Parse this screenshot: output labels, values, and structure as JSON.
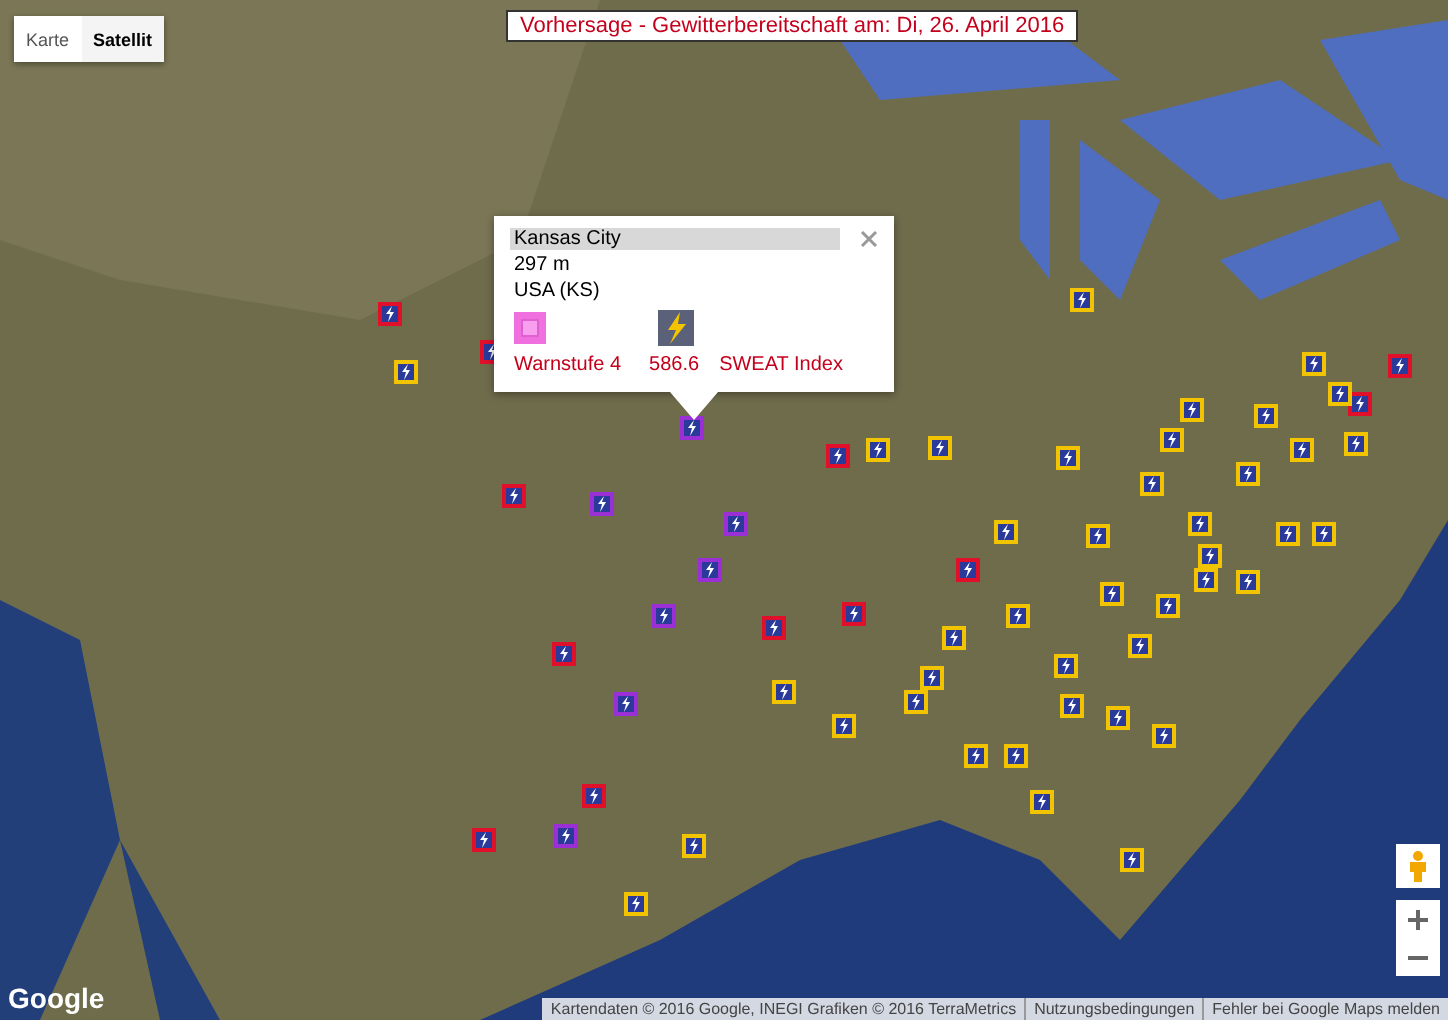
{
  "map_type_buttons": [
    {
      "label": "Karte",
      "selected": false
    },
    {
      "label": "Satellit",
      "selected": true
    }
  ],
  "title": "Vorhersage - Gewitterbereitschaft am: Di, 26. April 2016",
  "popup": {
    "place": "Kansas City",
    "elevation": "297 m",
    "region": "USA (KS)",
    "warning_label": "Warnstufe 4",
    "index_value": "586.6",
    "index_label": "SWEAT Index"
  },
  "markers": [
    {
      "color": "#e0102a"
    },
    {
      "color": "#e0102a"
    },
    {
      "color": "#e0102a"
    },
    {
      "color": "#e0102a"
    },
    {
      "color": "#e0102a"
    },
    {
      "color": "#e0102a"
    },
    {
      "color": "#e0102a"
    },
    {
      "color": "#e0102a"
    },
    {
      "color": "#e0102a"
    },
    {
      "color": "#e0102a"
    },
    {
      "color": "#e0102a"
    },
    {
      "color": "#e0102a"
    },
    {
      "color": "#9b2fd6"
    },
    {
      "color": "#9b2fd6"
    },
    {
      "color": "#9b2fd6"
    },
    {
      "color": "#9b2fd6"
    },
    {
      "color": "#9b2fd6"
    },
    {
      "color": "#9b2fd6"
    },
    {
      "color": "#9b2fd6"
    },
    {
      "color": "#f2c400"
    },
    {
      "color": "#f2c400"
    },
    {
      "color": "#f2c400"
    },
    {
      "color": "#f2c400"
    },
    {
      "color": "#f2c400"
    },
    {
      "color": "#f2c400"
    },
    {
      "color": "#f2c400"
    },
    {
      "color": "#f2c400"
    },
    {
      "color": "#f2c400"
    },
    {
      "color": "#f2c400"
    },
    {
      "color": "#f2c400"
    },
    {
      "color": "#f2c400"
    },
    {
      "color": "#f2c400"
    },
    {
      "color": "#f2c400"
    },
    {
      "color": "#f2c400"
    },
    {
      "color": "#f2c400"
    },
    {
      "color": "#f2c400"
    },
    {
      "color": "#f2c400"
    },
    {
      "color": "#f2c400"
    },
    {
      "color": "#f2c400"
    },
    {
      "color": "#f2c400"
    },
    {
      "color": "#f2c400"
    },
    {
      "color": "#f2c400"
    },
    {
      "color": "#f2c400"
    },
    {
      "color": "#f2c400"
    },
    {
      "color": "#f2c400"
    },
    {
      "color": "#f2c400"
    },
    {
      "color": "#f2c400"
    },
    {
      "color": "#f2c400"
    },
    {
      "color": "#f2c400"
    },
    {
      "color": "#f2c400"
    },
    {
      "color": "#f2c400"
    },
    {
      "color": "#f2c400"
    },
    {
      "color": "#f2c400"
    },
    {
      "color": "#f2c400"
    },
    {
      "color": "#f2c400"
    },
    {
      "color": "#f2c400"
    },
    {
      "color": "#f2c400"
    },
    {
      "color": "#f2c400"
    },
    {
      "color": "#f2c400"
    },
    {
      "color": "#f2c400"
    }
  ],
  "logo": "Google",
  "attribution": [
    "Kartendaten © 2016 Google, INEGI Grafiken © 2016 TerraMetrics",
    "Nutzungsbedingungen",
    "Fehler bei Google Maps melden"
  ]
}
